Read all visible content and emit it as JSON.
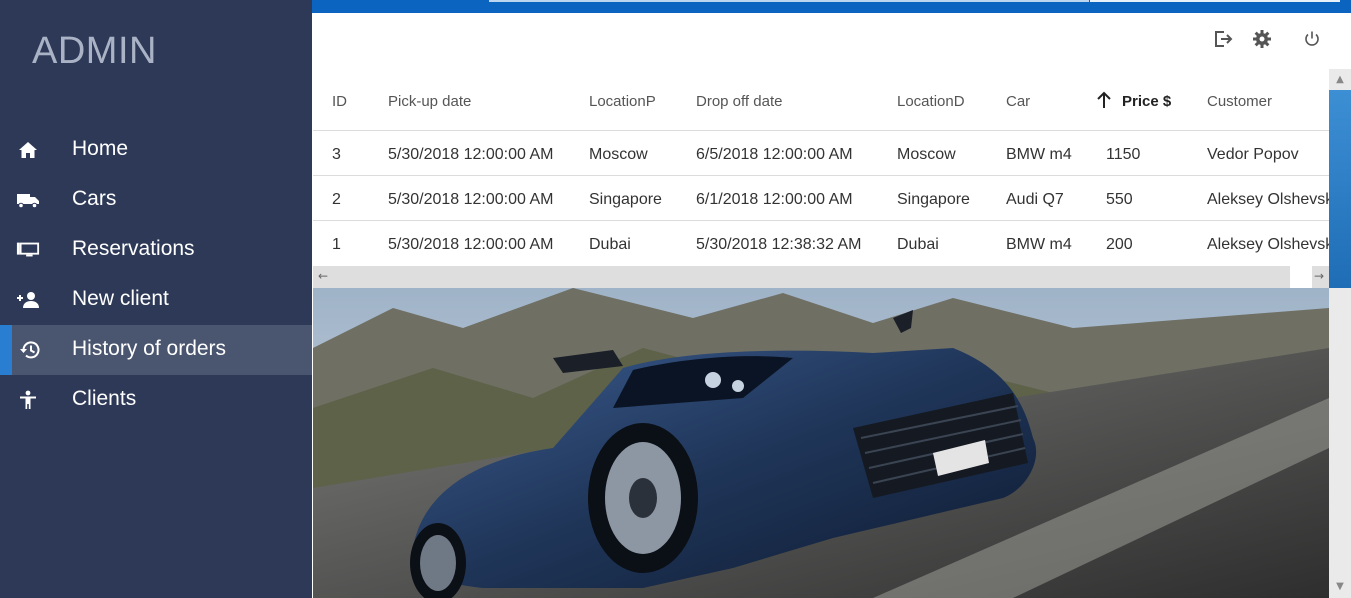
{
  "sidebar": {
    "brand": "ADMIN",
    "items": [
      {
        "label": "Home",
        "icon": "home-icon"
      },
      {
        "label": "Cars",
        "icon": "truck-icon"
      },
      {
        "label": "Reservations",
        "icon": "monitor-icon"
      },
      {
        "label": "New client",
        "icon": "person-add-icon"
      },
      {
        "label": "History of orders",
        "icon": "history-icon",
        "active": true
      },
      {
        "label": "Clients",
        "icon": "accessibility-icon"
      }
    ]
  },
  "header": {
    "actions": [
      "exit-icon",
      "gear-icon",
      "power-icon"
    ]
  },
  "table": {
    "columns": [
      "ID",
      "Pick-up date",
      "LocationP",
      "Drop off date",
      "LocationD",
      "Car",
      "Price $",
      "Customer"
    ],
    "sorted_column": "Price $",
    "rows": [
      [
        "3",
        "5/30/2018 12:00:00 AM",
        "Moscow",
        "6/5/2018 12:00:00 AM",
        "Moscow",
        "BMW m4",
        "1150",
        "Vedor Popov"
      ],
      [
        "2",
        "5/30/2018 12:00:00 AM",
        "Singapore",
        "6/1/2018 12:00:00 AM",
        "Singapore",
        "Audi Q7",
        "550",
        "Aleksey Olshevsk"
      ],
      [
        "1",
        "5/30/2018 12:00:00 AM",
        "Dubai",
        "5/30/2018 12:38:32 AM",
        "Dubai",
        "BMW m4",
        "200",
        "Aleksey Olshevsk"
      ]
    ]
  },
  "colors": {
    "sidebar_bg": "#2d3957",
    "sidebar_active": "#4a556f",
    "accent": "#0a64c0"
  }
}
